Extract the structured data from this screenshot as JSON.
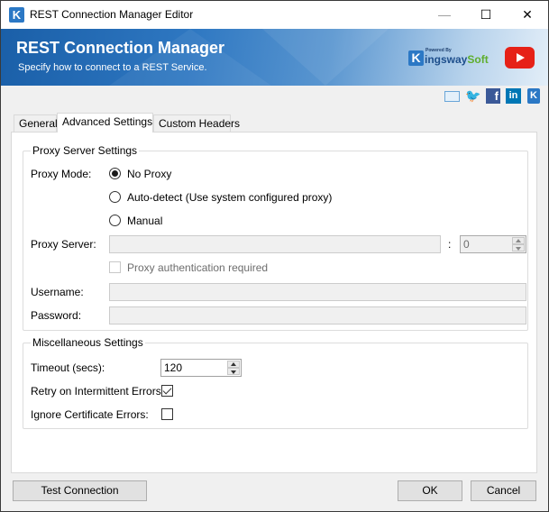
{
  "window": {
    "title": "REST Connection Manager Editor",
    "controls": {
      "minimize": "—",
      "maximize": "☐",
      "close": "✕"
    }
  },
  "banner": {
    "title": "REST Connection Manager",
    "subtitle": "Specify how to connect to a REST Service.",
    "logo": {
      "powered_by": "Powered By",
      "name_part1": "ingsway",
      "name_part2": "Soft",
      "k": "K"
    },
    "youtube_icon": "youtube-icon"
  },
  "social": [
    {
      "name": "email-icon",
      "glyph": ""
    },
    {
      "name": "twitter-icon",
      "glyph": "🐦"
    },
    {
      "name": "facebook-icon",
      "glyph": "f"
    },
    {
      "name": "linkedin-icon",
      "glyph": "in"
    },
    {
      "name": "kingswaysoft-icon",
      "glyph": "K"
    }
  ],
  "tabs": [
    {
      "label": "General",
      "active": false
    },
    {
      "label": "Advanced Settings",
      "active": true
    },
    {
      "label": "Custom Headers",
      "active": false
    }
  ],
  "proxy": {
    "legend": "Proxy Server Settings",
    "mode_label": "Proxy Mode:",
    "modes": [
      {
        "label": "No Proxy",
        "checked": true
      },
      {
        "label": "Auto-detect (Use system configured proxy)",
        "checked": false
      },
      {
        "label": "Manual",
        "checked": false
      }
    ],
    "server_label": "Proxy Server:",
    "server_value": "",
    "port_separator": ":",
    "port_value": "0",
    "auth_label": "Proxy authentication required",
    "auth_checked": false,
    "username_label": "Username:",
    "username_value": "",
    "password_label": "Password:",
    "password_value": ""
  },
  "misc": {
    "legend": "Miscellaneous Settings",
    "timeout_label": "Timeout (secs):",
    "timeout_value": "120",
    "retry_label": "Retry on Intermittent Errors:",
    "retry_checked": true,
    "ignore_cert_label": "Ignore Certificate Errors:",
    "ignore_cert_checked": false
  },
  "buttons": {
    "test_connection": "Test Connection",
    "ok": "OK",
    "cancel": "Cancel"
  }
}
